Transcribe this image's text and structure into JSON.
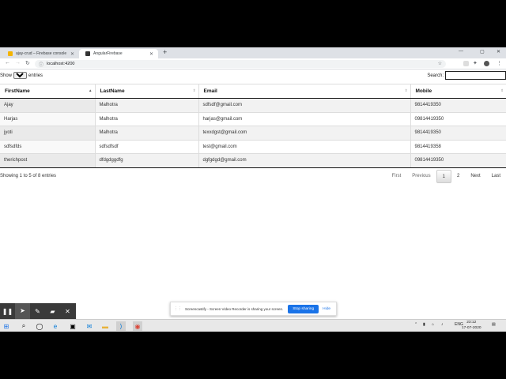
{
  "browser": {
    "tabs": [
      {
        "title": "ajay-crud – Firebase console",
        "active": false,
        "icon_color": "#f4b400"
      },
      {
        "title": "AngularFirebase",
        "active": true,
        "icon_color": "#333333"
      }
    ],
    "url": "localhost:4200"
  },
  "table_controls": {
    "show_label": "Show",
    "page_size": "5",
    "entries_label": "entries",
    "search_label": "Search:",
    "search_value": ""
  },
  "table": {
    "columns": [
      "FirstName",
      "LastName",
      "Email",
      "Mobile"
    ],
    "rows": [
      [
        "Ajay",
        "Malhotra",
        "sdfsdf@gmail.com",
        "9814419350"
      ],
      [
        "Harjas",
        "Malhotra",
        "harjas@gmail.com",
        "09814419350"
      ],
      [
        "jyoti",
        "Malhotra",
        "texxdgst@gmail.com",
        "9814419350"
      ],
      [
        "sdfsdfds",
        "sdfsdfsdf",
        "test@gmail.com",
        "9814419358"
      ],
      [
        "therichpost",
        "dfdgdggdfg",
        "dgfgdgd@gmail.com",
        "09814419350"
      ]
    ]
  },
  "info": "Showing 1 to 5 of 8 entries",
  "pager": {
    "first": "First",
    "previous": "Previous",
    "pages": [
      "1",
      "2"
    ],
    "current": "1",
    "next": "Next",
    "last": "Last"
  },
  "share_banner": {
    "message": "Screencastify - Screen Video Recorder is sharing your screen.",
    "stop": "Stop sharing",
    "hide": "Hide"
  },
  "taskbar": {
    "lang": "ENG",
    "time": "23:12",
    "date": "17-07-2020"
  },
  "colors": {
    "accent": "#1a73e8"
  }
}
